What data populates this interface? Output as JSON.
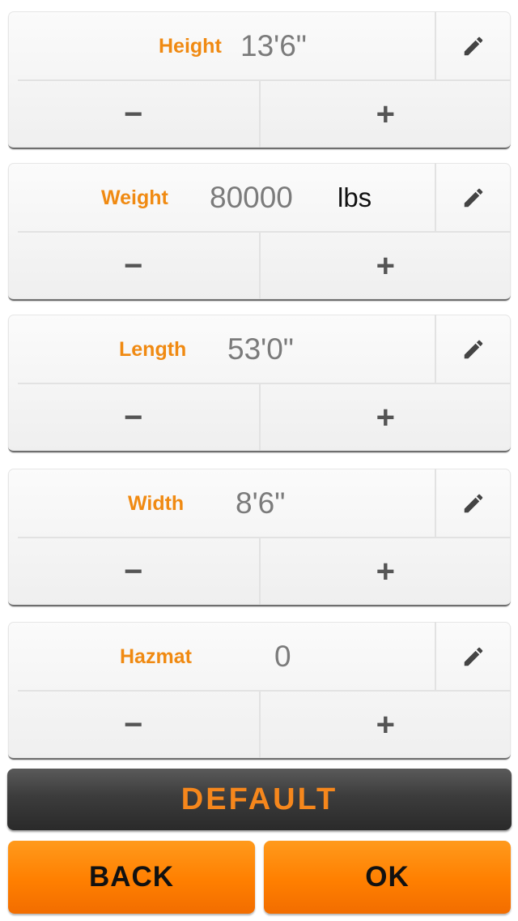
{
  "fields": [
    {
      "label": "Height",
      "value": "13'6\"",
      "unit": ""
    },
    {
      "label": "Weight",
      "value": "80000",
      "unit": "lbs"
    },
    {
      "label": "Length",
      "value": "53'0\"",
      "unit": ""
    },
    {
      "label": "Width",
      "value": "8'6\"",
      "unit": ""
    },
    {
      "label": "Hazmat",
      "value": "0",
      "unit": ""
    }
  ],
  "stepper": {
    "minus": "−",
    "plus": "+"
  },
  "icons": {
    "edit": "pencil-icon"
  },
  "buttons": {
    "default": "DEFAULT",
    "back": "BACK",
    "ok": "OK"
  },
  "colors": {
    "label": "#f08a12",
    "value": "#7b7b7b",
    "accent": "#ff8000",
    "dark_button": "#3c3c3c"
  }
}
